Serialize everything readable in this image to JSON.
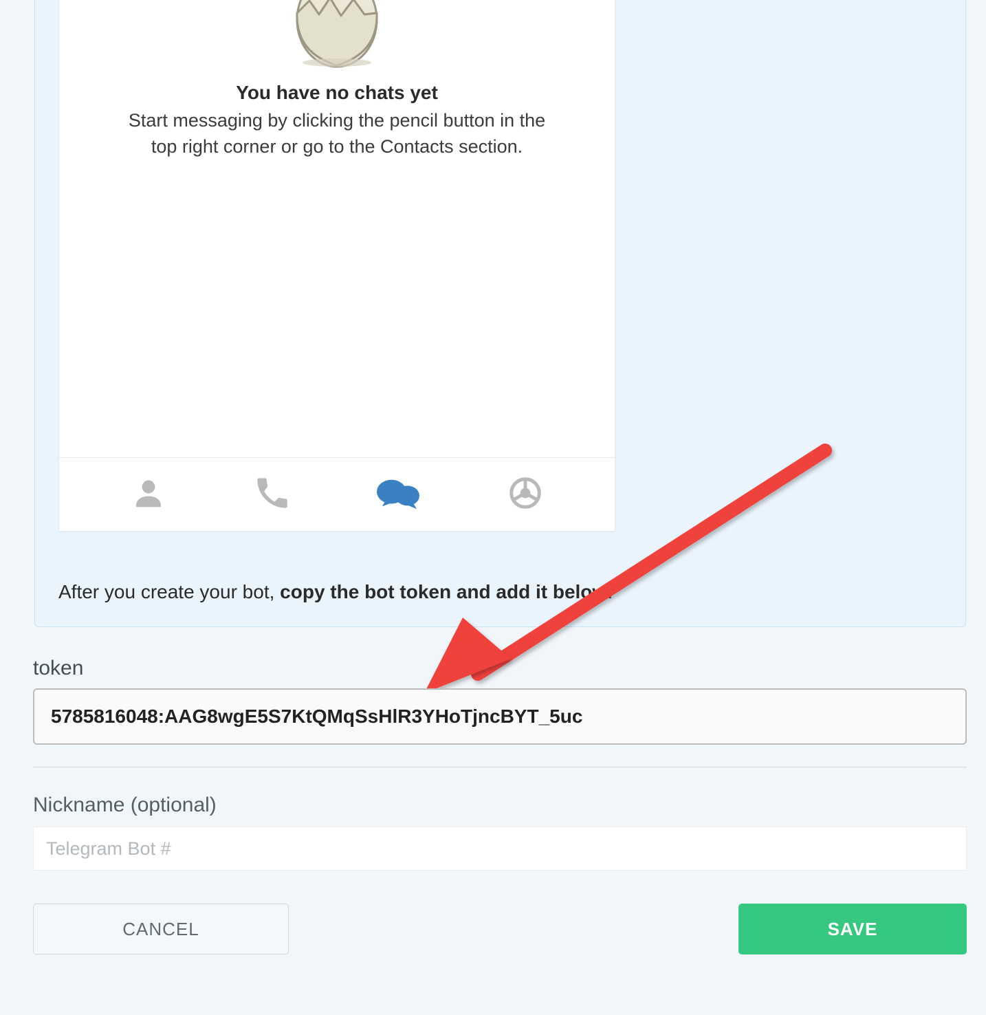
{
  "phone": {
    "empty_title": "You have no chats yet",
    "empty_subtitle": "Start messaging by clicking the pencil button in the top right corner or go to the Contacts section."
  },
  "instruction": {
    "prefix": "After you create your bot, ",
    "bold": "copy the bot token and add it below",
    "suffix": "."
  },
  "form": {
    "token_label": "token",
    "token_value": "5785816048:AAG8wgE5S7KtQMqSsHlR3YHoTjncBYT_5uc",
    "nickname_label": "Nickname (optional)",
    "nickname_placeholder": "Telegram Bot #"
  },
  "buttons": {
    "cancel": "CANCEL",
    "save": "SAVE"
  },
  "colors": {
    "accent_save": "#36c880",
    "arrow": "#f0423e",
    "tab_active": "#3a81c4"
  }
}
